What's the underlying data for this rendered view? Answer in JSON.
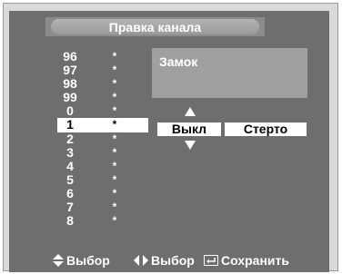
{
  "menu": {
    "title": "Правка канала"
  },
  "channels": [
    {
      "number": "96",
      "mark": "*"
    },
    {
      "number": "97",
      "mark": "*"
    },
    {
      "number": "98",
      "mark": "*"
    },
    {
      "number": "99",
      "mark": "*"
    },
    {
      "number": "0",
      "mark": "*"
    },
    {
      "number": "1",
      "mark": "*"
    },
    {
      "number": "2",
      "mark": "*"
    },
    {
      "number": "3",
      "mark": "*"
    },
    {
      "number": "4",
      "mark": "*"
    },
    {
      "number": "5",
      "mark": "*"
    },
    {
      "number": "6",
      "mark": "*"
    },
    {
      "number": "7",
      "mark": "*"
    },
    {
      "number": "8",
      "mark": "*"
    }
  ],
  "selected_channel_index": 5,
  "lock_panel": {
    "label": "Замок"
  },
  "options": {
    "lock_value": "Выкл",
    "erase_value": "Стерто"
  },
  "hints": {
    "updown": {
      "icon": "up-down-arrow-icon",
      "label": "Выбор"
    },
    "leftright": {
      "icon": "left-right-arrow-icon",
      "label": "Выбор"
    },
    "enter": {
      "icon": "enter-icon",
      "label": "Сохранить"
    }
  },
  "colors": {
    "screen_bg": "#6e6e6e",
    "title_bg": "#8c8c8c",
    "panel_bg": "#a0a0a0",
    "highlight": "#ffffff",
    "text": "#ffffff"
  }
}
